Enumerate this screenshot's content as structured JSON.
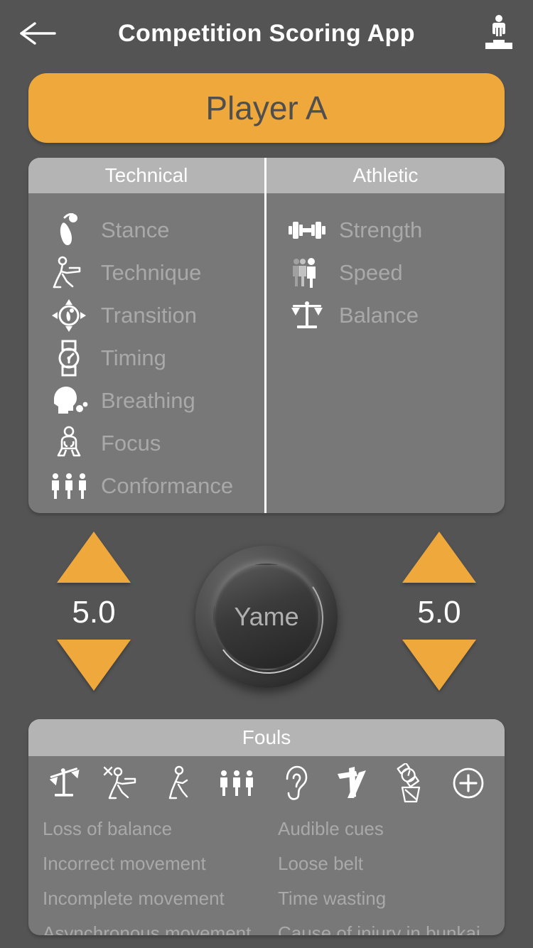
{
  "header": {
    "title": "Competition Scoring App",
    "back_icon": "back-arrow-icon",
    "podium_icon": "podium-winner-icon"
  },
  "player": {
    "label": "Player A",
    "accent_color": "#efa83c",
    "text_color": "#4f4f4f"
  },
  "criteria": {
    "columns": [
      {
        "header": "Technical",
        "items": [
          {
            "label": "Stance",
            "icon": "footprint-icon"
          },
          {
            "label": "Technique",
            "icon": "fighter-stance-icon"
          },
          {
            "label": "Transition",
            "icon": "compass-footprint-icon"
          },
          {
            "label": "Timing",
            "icon": "wristwatch-icon"
          },
          {
            "label": "Breathing",
            "icon": "head-breath-icon"
          },
          {
            "label": "Focus",
            "icon": "meditating-figure-icon"
          },
          {
            "label": "Conformance",
            "icon": "three-figures-icon"
          }
        ]
      },
      {
        "header": "Athletic",
        "items": [
          {
            "label": "Strength",
            "icon": "dumbbell-icon"
          },
          {
            "label": "Speed",
            "icon": "motion-figure-icon"
          },
          {
            "label": "Balance",
            "icon": "scales-icon"
          }
        ]
      }
    ]
  },
  "scoring": {
    "left": {
      "value": "5.0",
      "up_icon": "triangle-up-icon",
      "down_icon": "triangle-down-icon"
    },
    "right": {
      "value": "5.0",
      "up_icon": "triangle-up-icon",
      "down_icon": "triangle-down-icon"
    },
    "center_button": {
      "label": "Yame"
    }
  },
  "fouls": {
    "header": "Fouls",
    "icons": [
      "tilted-scales-icon",
      "incorrect-movement-icon",
      "incomplete-movement-icon",
      "three-figures-icon",
      "ear-icon",
      "loose-belt-icon",
      "watch-in-trash-icon",
      "plus-circle-icon"
    ],
    "left_labels": [
      "Loss of balance",
      "Incorrect movement",
      "Incomplete movement",
      "Asynchronous movement"
    ],
    "right_labels": [
      "Audible cues",
      "Loose belt",
      "Time wasting",
      "Cause of injury in bunkai"
    ]
  },
  "colors": {
    "page_background": "#545454",
    "panel_background": "#787878",
    "panel_header": "#b4b4b4",
    "accent_orange": "#efa83c",
    "muted_text": "#a9a9a9"
  }
}
